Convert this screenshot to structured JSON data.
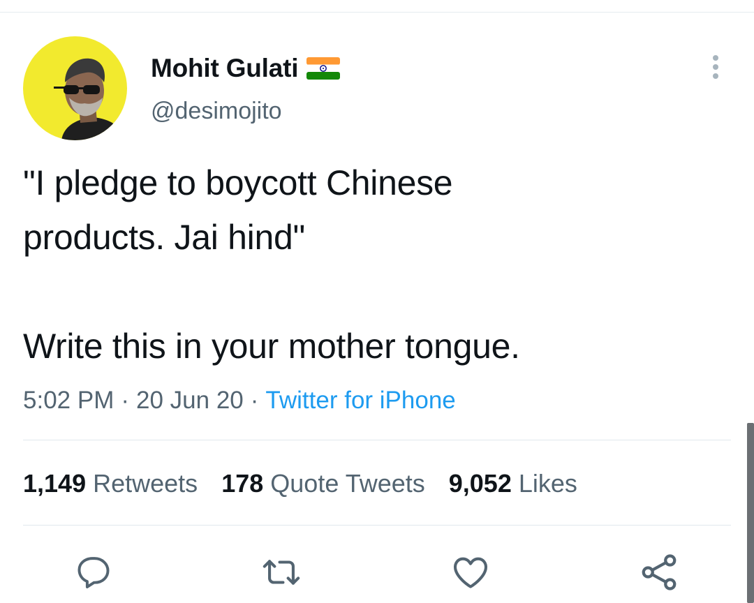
{
  "tweet": {
    "author": {
      "display_name": "Mohit Gulati",
      "handle": "@desimojito",
      "avatar_icon": "avatar-photo",
      "badge_icon": "india-flag-icon"
    },
    "text": "\"I pledge to boycott Chinese\nproducts. Jai hind\"\n\nWrite this in your mother tongue.",
    "meta": {
      "time": "5:02 PM",
      "separator": "·",
      "date": "20 Jun 20",
      "source": "Twitter for iPhone"
    },
    "stats": {
      "retweets_count": "1,149",
      "retweets_label": "Retweets",
      "quotes_count": "178",
      "quotes_label": "Quote Tweets",
      "likes_count": "9,052",
      "likes_label": "Likes"
    },
    "actions": [
      "reply-icon",
      "retweet-icon",
      "like-icon",
      "share-icon"
    ]
  },
  "colors": {
    "text_primary": "#0f1419",
    "text_secondary": "#536471",
    "link": "#1d9bf0",
    "avatar_bg": "#f2ea2e",
    "divider": "#e1e8ed"
  }
}
